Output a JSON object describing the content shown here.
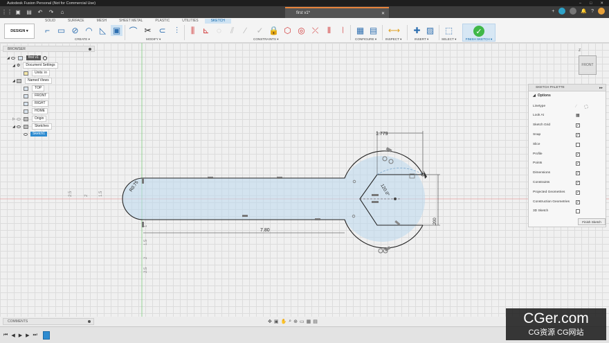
{
  "window": {
    "title": "Autodesk Fusion Personal (Not for Commercial Use)",
    "controls": [
      "–",
      "□",
      "✕"
    ]
  },
  "document": {
    "tab_title": "first v1*"
  },
  "ribbon": {
    "tabs": [
      "SOLID",
      "SURFACE",
      "MESH",
      "SHEET METAL",
      "PLASTIC",
      "UTILITIES",
      "SKETCH"
    ],
    "active_tab": "SKETCH",
    "workspace": "DESIGN ▾",
    "groups": [
      "CREATE ▾",
      "MODIFY ▾",
      "CONSTRAINTS ▾",
      "CONFIGURE ▾",
      "INSPECT ▾",
      "INSERT ▾",
      "SELECT ▾"
    ],
    "finish_sketch": "FINISH SKETCH ▾"
  },
  "browser": {
    "title": "BROWSER",
    "items": [
      {
        "label": "first v1",
        "level": 0
      },
      {
        "label": "Document Settings",
        "level": 1
      },
      {
        "label": "Units: in",
        "level": 2
      },
      {
        "label": "Named Views",
        "level": 1
      },
      {
        "label": "TOP",
        "level": 2
      },
      {
        "label": "FRONT",
        "level": 2
      },
      {
        "label": "RIGHT",
        "level": 2
      },
      {
        "label": "HOME",
        "level": 2
      },
      {
        "label": "Origin",
        "level": 1
      },
      {
        "label": "Sketches",
        "level": 1
      },
      {
        "label": "Sketch1",
        "level": 2
      }
    ]
  },
  "viewcube": {
    "face": "FRONT",
    "axis": "Z"
  },
  "sketch": {
    "dimensions": {
      "width": "1.779",
      "length": "7.80",
      "height": ".200",
      "radius": "R0.75",
      "angle": "120.0°"
    },
    "ruler_x": [
      "2.5",
      "2",
      "1.5"
    ],
    "ruler_y": [
      "1",
      "1.5",
      "2",
      "2.5"
    ]
  },
  "palette": {
    "title": "SKETCH PALETTE",
    "section": "Options",
    "rows": [
      {
        "label": "Linetype",
        "kind": "linetype"
      },
      {
        "label": "Look At",
        "kind": "icon"
      },
      {
        "label": "Sketch Grid",
        "checked": true
      },
      {
        "label": "Snap",
        "checked": true
      },
      {
        "label": "Slice",
        "checked": false
      },
      {
        "label": "Profile",
        "checked": true
      },
      {
        "label": "Points",
        "checked": true
      },
      {
        "label": "Dimensions",
        "checked": true
      },
      {
        "label": "Constraints",
        "checked": true
      },
      {
        "label": "Projected Geometries",
        "checked": true
      },
      {
        "label": "Construction Geometries",
        "checked": true
      },
      {
        "label": "3D Sketch",
        "checked": false
      }
    ],
    "finish_button": "Finish Sketch"
  },
  "comments": {
    "label": "COMMENTS"
  },
  "watermark": {
    "line1": "CGer.com",
    "line2": "CG资源 CG网站"
  }
}
